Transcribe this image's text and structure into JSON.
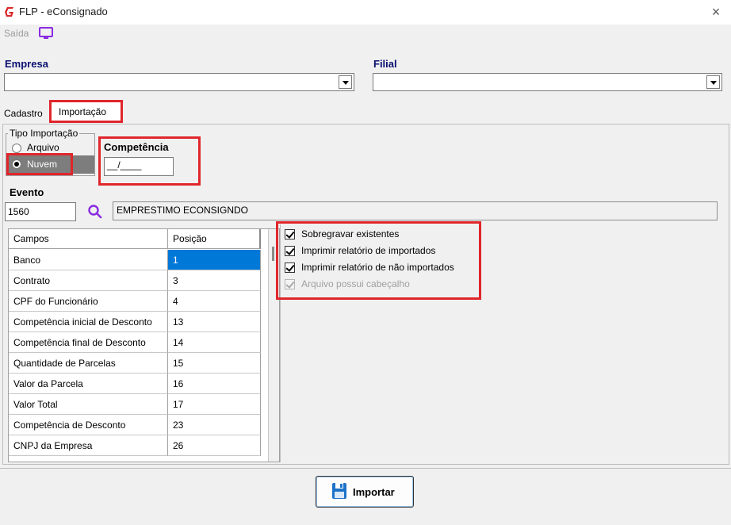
{
  "window": {
    "title": "FLP - eConsignado",
    "close_icon": "×"
  },
  "menu": {
    "saida_label": "Saída"
  },
  "empresa": {
    "label": "Empresa",
    "value": ""
  },
  "filial": {
    "label": "Filial",
    "value": ""
  },
  "tabs": [
    {
      "label": "Cadastro"
    },
    {
      "label": "Importação"
    }
  ],
  "tipo_importacao": {
    "title": "Tipo Importação",
    "options": [
      {
        "label": "Arquivo",
        "selected": false
      },
      {
        "label": "Nuvem",
        "selected": true
      }
    ]
  },
  "competencia": {
    "label": "Competência",
    "value": "__/____"
  },
  "evento": {
    "label": "Evento",
    "code": "1560",
    "description": "EMPRESTIMO ECONSIGNDO"
  },
  "grid": {
    "headers": [
      "Campos",
      "Posição"
    ],
    "rows": [
      {
        "campo": "Banco",
        "posicao": "1"
      },
      {
        "campo": "Contrato",
        "posicao": "3"
      },
      {
        "campo": "CPF do Funcionário",
        "posicao": "4"
      },
      {
        "campo": "Competência inicial de Desconto",
        "posicao": "13"
      },
      {
        "campo": "Competência final de Desconto",
        "posicao": "14"
      },
      {
        "campo": "Quantidade de Parcelas",
        "posicao": "15"
      },
      {
        "campo": "Valor da Parcela",
        "posicao": "16"
      },
      {
        "campo": "Valor Total",
        "posicao": "17"
      },
      {
        "campo": "Competência de Desconto",
        "posicao": "23"
      },
      {
        "campo": "CNPJ da Empresa",
        "posicao": "26"
      }
    ]
  },
  "options": [
    {
      "label": "Sobregravar existentes",
      "checked": true,
      "enabled": true
    },
    {
      "label": "Imprimir relatório de importados",
      "checked": true,
      "enabled": true
    },
    {
      "label": "Imprimir relatório de não importados",
      "checked": true,
      "enabled": true
    },
    {
      "label": "Arquivo possui cabeçalho",
      "checked": true,
      "enabled": false
    }
  ],
  "import_button": {
    "label": "Importar"
  },
  "colors": {
    "accent_red": "#e0262b",
    "selection": "#0078d7",
    "label_blue": "#0a1070",
    "icon_purple": "#8a2be2"
  }
}
